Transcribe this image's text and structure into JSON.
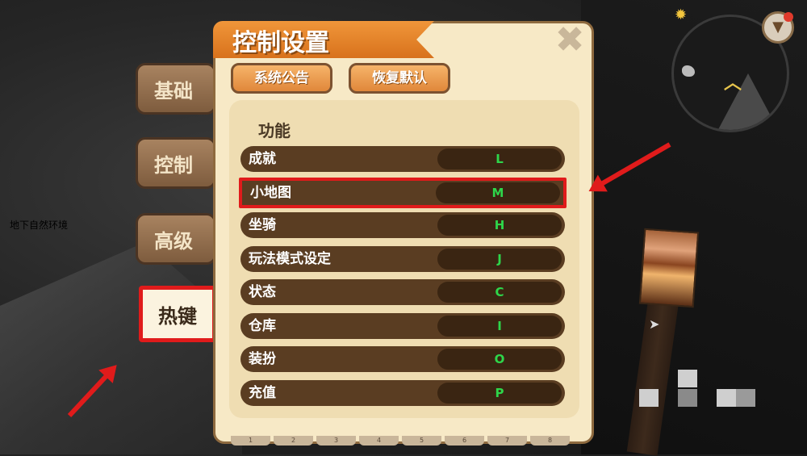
{
  "background": {
    "caption": "地下自然环境"
  },
  "panel": {
    "title": "控制设置",
    "buttons": {
      "notice": "系统公告",
      "restore": "恢复默认"
    },
    "section_title": "功能"
  },
  "side_tabs": [
    {
      "label": "基础"
    },
    {
      "label": "控制"
    },
    {
      "label": "高级"
    },
    {
      "label": "热键"
    }
  ],
  "hotkeys": [
    {
      "label": "成就",
      "key": "L"
    },
    {
      "label": "小地图",
      "key": "M"
    },
    {
      "label": "坐骑",
      "key": "H"
    },
    {
      "label": "玩法模式设定",
      "key": "J"
    },
    {
      "label": "状态",
      "key": "C"
    },
    {
      "label": "仓库",
      "key": "I"
    },
    {
      "label": "装扮",
      "key": "O"
    },
    {
      "label": "充值",
      "key": "P"
    }
  ],
  "bottom_tab_numbers": [
    "1",
    "2",
    "3",
    "4",
    "5",
    "6",
    "7",
    "8"
  ],
  "colors": {
    "accent": "#e0873a",
    "key_text": "#2ed64a",
    "annotation": "#e01b1b"
  }
}
